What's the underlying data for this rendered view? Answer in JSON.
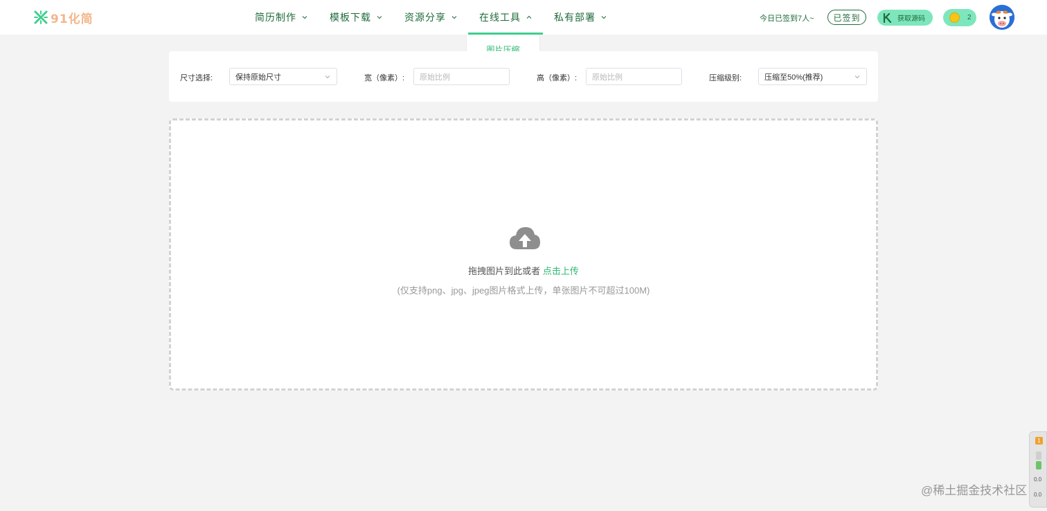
{
  "brand": {
    "logo_text": "91化简",
    "accent": "#3ecf8e",
    "dark_green": "#1f6b3a"
  },
  "nav": {
    "items": [
      {
        "label": "简历制作",
        "chevron": "chevron-down-icon"
      },
      {
        "label": "模板下载",
        "chevron": "chevron-down-icon"
      },
      {
        "label": "资源分享",
        "chevron": "chevron-down-icon"
      },
      {
        "label": "在线工具",
        "chevron": "chevron-up-icon",
        "active": true
      },
      {
        "label": "私有部署",
        "chevron": "chevron-down-icon"
      }
    ],
    "dropdown_item": "图片压缩"
  },
  "user": {
    "signin_text": "今日已签到7人~",
    "signed_label": "已签到",
    "source_label": "获取源码",
    "coin_count": "2"
  },
  "settings": {
    "size_label": "尺寸选择:",
    "size_value": "保持原始尺寸",
    "width_label": "宽（像素）:",
    "width_placeholder": "原始比例",
    "height_label": "高（像素）:",
    "height_placeholder": "原始比例",
    "level_label": "压缩级别:",
    "level_value": "压缩至50%(推荐)"
  },
  "upload": {
    "prompt": "拖拽图片到此或者",
    "link": "点击上传",
    "hint": "(仅支持png、jpg、jpeg图片格式上传，单张图片不可超过100M)"
  },
  "side_widget": {
    "badge": "1",
    "value_1": "0.0",
    "value_2": "0.0"
  },
  "watermark": "@稀土掘金技术社区"
}
